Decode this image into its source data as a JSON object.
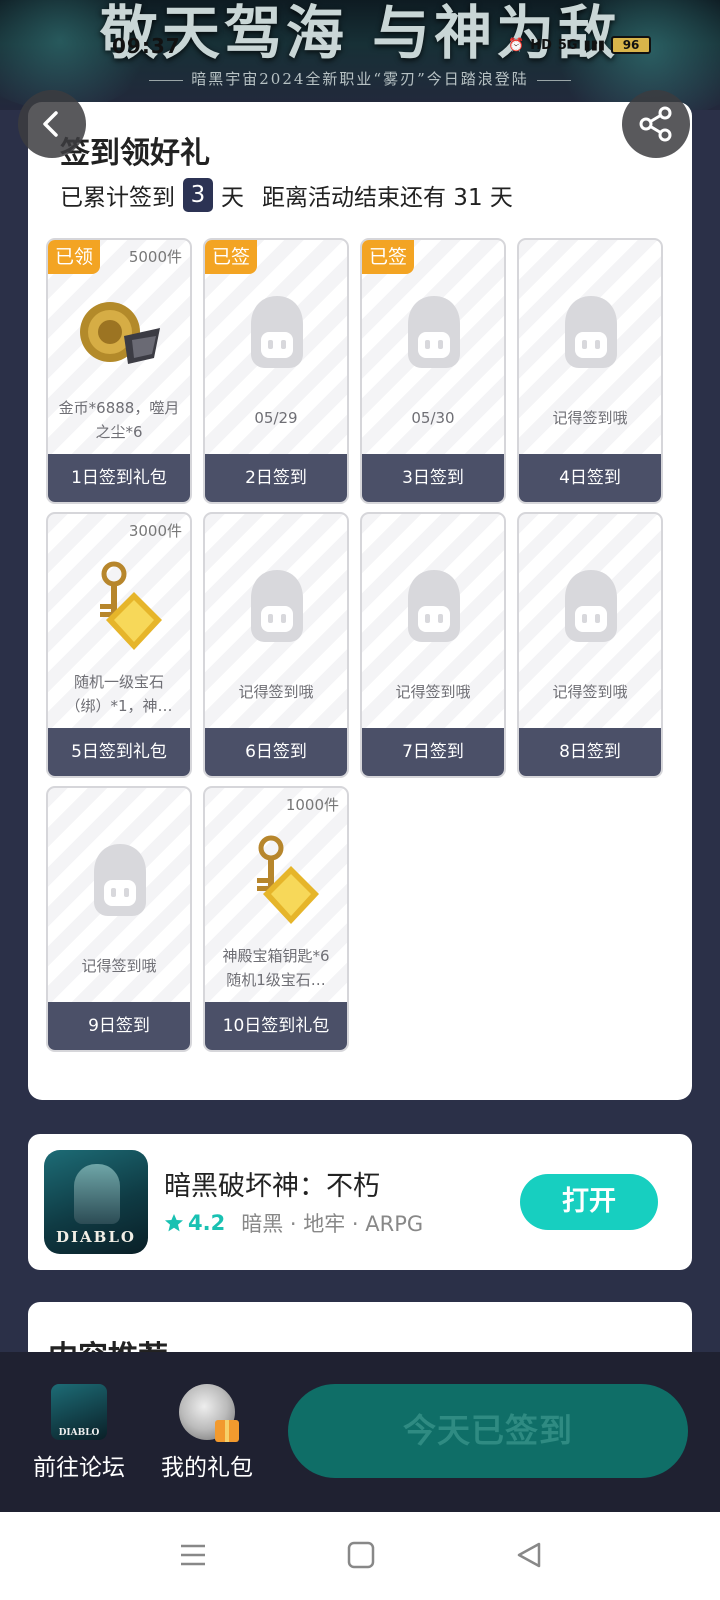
{
  "status": {
    "time": "09:37",
    "battery": "96",
    "network": "5G"
  },
  "banner": {
    "title": "敬天驾海 与神为敌",
    "subtitle": "暗黑宇宙2024全新职业“雾刃”今日踏浪登陆"
  },
  "signin": {
    "title": "签到领好礼",
    "prefix": "已累计签到",
    "days": "3",
    "unit": "天",
    "end_text": "距离活动结束还有 31 天",
    "cards": [
      {
        "tag": "已领",
        "count": "5000件",
        "desc": "金币*6888，噬月之尘*6",
        "label": "1日签到礼包",
        "art": "coin"
      },
      {
        "tag": "已签",
        "count": "",
        "desc": "05/29",
        "label": "2日签到",
        "art": "placeholder"
      },
      {
        "tag": "已签",
        "count": "",
        "desc": "05/30",
        "label": "3日签到",
        "art": "placeholder"
      },
      {
        "tag": "",
        "count": "",
        "desc": "记得签到哦",
        "label": "4日签到",
        "art": "placeholder"
      },
      {
        "tag": "",
        "count": "3000件",
        "desc": "随机一级宝石（绑）*1，神…",
        "label": "5日签到礼包",
        "art": "key"
      },
      {
        "tag": "",
        "count": "",
        "desc": "记得签到哦",
        "label": "6日签到",
        "art": "placeholder"
      },
      {
        "tag": "",
        "count": "",
        "desc": "记得签到哦",
        "label": "7日签到",
        "art": "placeholder"
      },
      {
        "tag": "",
        "count": "",
        "desc": "记得签到哦",
        "label": "8日签到",
        "art": "placeholder"
      },
      {
        "tag": "",
        "count": "",
        "desc": "记得签到哦",
        "label": "9日签到",
        "art": "placeholder"
      },
      {
        "tag": "",
        "count": "1000件",
        "desc": "神殿宝箱钥匙*6 随机1级宝石…",
        "label": "10日签到礼包",
        "art": "key"
      }
    ]
  },
  "app": {
    "name": "暗黑破坏神：不朽",
    "rating": "4.2",
    "genre": "暗黑 · 地牢 · ARPG",
    "open_label": "打开",
    "icon_logo": "DIABLO"
  },
  "recommend": {
    "title": "内容推荐"
  },
  "bottom": {
    "forum_label": "前往论坛",
    "gift_label": "我的礼包",
    "signed_label": "今天已签到",
    "forum_logo": "DIABLO"
  },
  "colors": {
    "accent": "#17cfc0",
    "tag": "#f3a423",
    "card_foot": "#4b5068",
    "signed_btn": "#0f6e67"
  }
}
